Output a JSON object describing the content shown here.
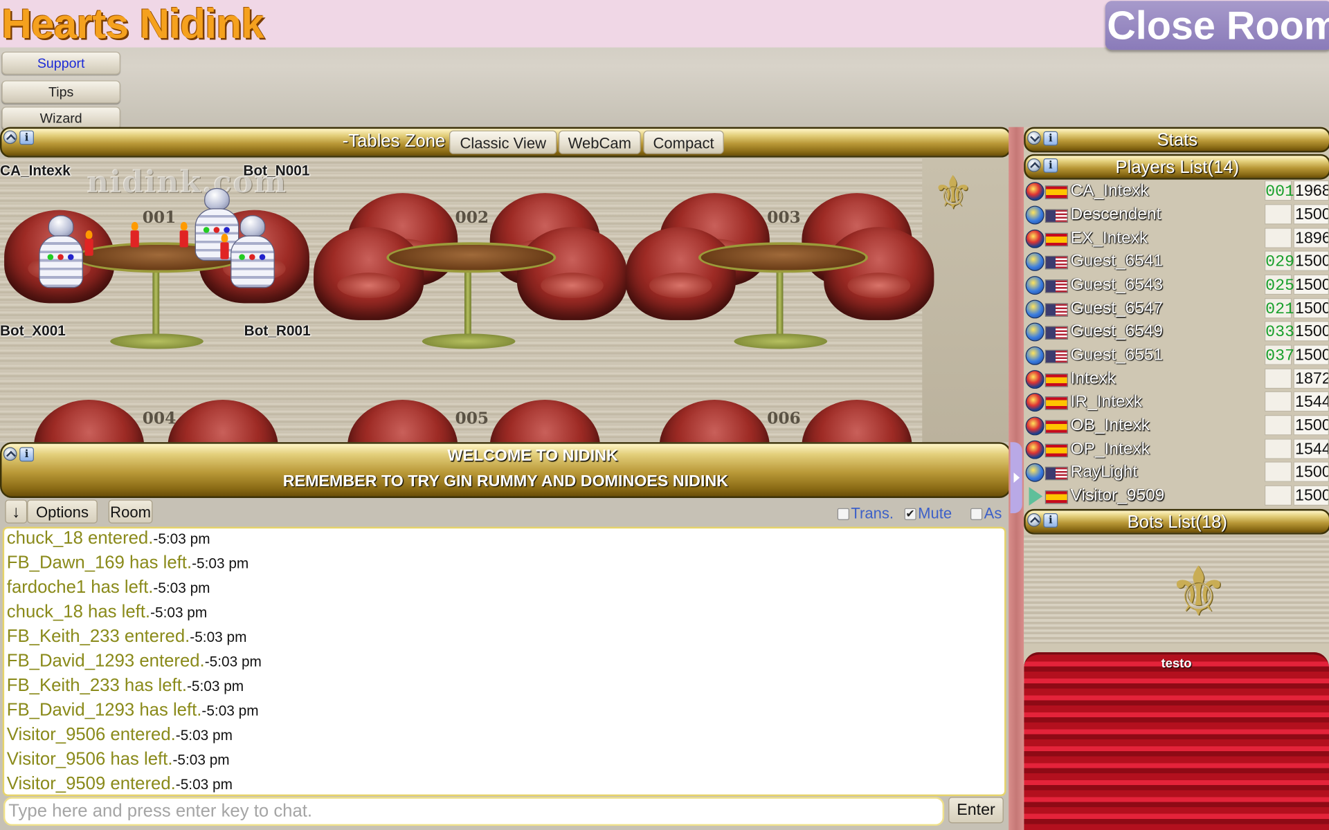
{
  "header": {
    "app_title": "Hearts Nidink",
    "close_room_label": "Close Room"
  },
  "menu": {
    "support": "Support",
    "tips": "Tips",
    "wizard": "Wizard"
  },
  "tables_zone": {
    "title": "-Tables Zone",
    "tabs": [
      "Classic View",
      "WebCam",
      "Compact"
    ],
    "watermark": "nidink.com",
    "tables": [
      {
        "number": "001",
        "seats": [
          "CA_Intexk",
          "Bot_N001",
          "Bot_X001",
          "Bot_R001"
        ]
      },
      {
        "number": "002"
      },
      {
        "number": "003"
      },
      {
        "number": "004"
      },
      {
        "number": "005"
      },
      {
        "number": "006"
      }
    ]
  },
  "welcome": {
    "line1": "WELCOME TO NIDINK",
    "line2": "REMEMBER TO TRY GIN RUMMY AND DOMINOES NIDINK"
  },
  "chat_toolbar": {
    "arrow": "↓",
    "options": "Options",
    "room": "Room",
    "trans": "Trans.",
    "mute": "Mute",
    "as": "As",
    "mute_checked": true
  },
  "chat": {
    "messages": [
      {
        "text": "chuck_18 entered.",
        "time": "-5:03 pm"
      },
      {
        "text": "FB_Dawn_169 has left.",
        "time": "-5:03 pm"
      },
      {
        "text": "fardoche1 has left.",
        "time": "-5:03 pm"
      },
      {
        "text": "chuck_18 has left.",
        "time": "-5:03 pm"
      },
      {
        "text": "FB_Keith_233 entered.",
        "time": "-5:03 pm"
      },
      {
        "text": "FB_David_1293 entered.",
        "time": "-5:03 pm"
      },
      {
        "text": "FB_Keith_233 has left.",
        "time": "-5:03 pm"
      },
      {
        "text": "FB_David_1293 has left.",
        "time": "-5:03 pm"
      },
      {
        "text": "Visitor_9506 entered.",
        "time": "-5:03 pm"
      },
      {
        "text": "Visitor_9506 has left.",
        "time": "-5:03 pm"
      },
      {
        "text": "Visitor_9509 entered.",
        "time": "-5:03 pm"
      }
    ],
    "input_placeholder": "Type here and press enter key to chat.",
    "enter_label": "Enter"
  },
  "right_panel": {
    "stats_title": "Stats",
    "players_title": "Players List(14)",
    "bots_title": "Bots List(18)",
    "stage_label": "testo",
    "players": [
      {
        "name": "CA_Intexk",
        "flag": "es",
        "table": "001",
        "rating": "1968",
        "avatar": "robot"
      },
      {
        "name": "Descendent",
        "flag": "us",
        "table": "",
        "rating": "1500",
        "avatar": "globe"
      },
      {
        "name": "EX_Intexk",
        "flag": "es",
        "table": "",
        "rating": "1896",
        "avatar": "robot"
      },
      {
        "name": "Guest_6541",
        "flag": "us",
        "table": "029",
        "rating": "1500",
        "avatar": "globe"
      },
      {
        "name": "Guest_6543",
        "flag": "us",
        "table": "025",
        "rating": "1500",
        "avatar": "globe"
      },
      {
        "name": "Guest_6547",
        "flag": "us",
        "table": "021",
        "rating": "1500",
        "avatar": "globe"
      },
      {
        "name": "Guest_6549",
        "flag": "us",
        "table": "033",
        "rating": "1500",
        "avatar": "globe"
      },
      {
        "name": "Guest_6551",
        "flag": "us",
        "table": "037",
        "rating": "1500",
        "avatar": "globe"
      },
      {
        "name": "Intexk",
        "flag": "es",
        "table": "",
        "rating": "1872",
        "avatar": "robot"
      },
      {
        "name": "IR_Intexk",
        "flag": "es",
        "table": "",
        "rating": "1544",
        "avatar": "robot"
      },
      {
        "name": "OB_Intexk",
        "flag": "es",
        "table": "",
        "rating": "1500",
        "avatar": "robot"
      },
      {
        "name": "OP_Intexk",
        "flag": "es",
        "table": "",
        "rating": "1544",
        "avatar": "robot"
      },
      {
        "name": "RayLight",
        "flag": "us",
        "table": "",
        "rating": "1500",
        "avatar": "globe"
      },
      {
        "name": "Visitor_9509",
        "flag": "es",
        "table": "",
        "rating": "1500",
        "avatar": "arrow"
      }
    ]
  },
  "colors": {
    "title_orange": "#f5a11e",
    "close_room_purple": "#8a7bb9",
    "chat_event_olive": "#8a8a1a",
    "table_number_green": "#19a02c"
  }
}
